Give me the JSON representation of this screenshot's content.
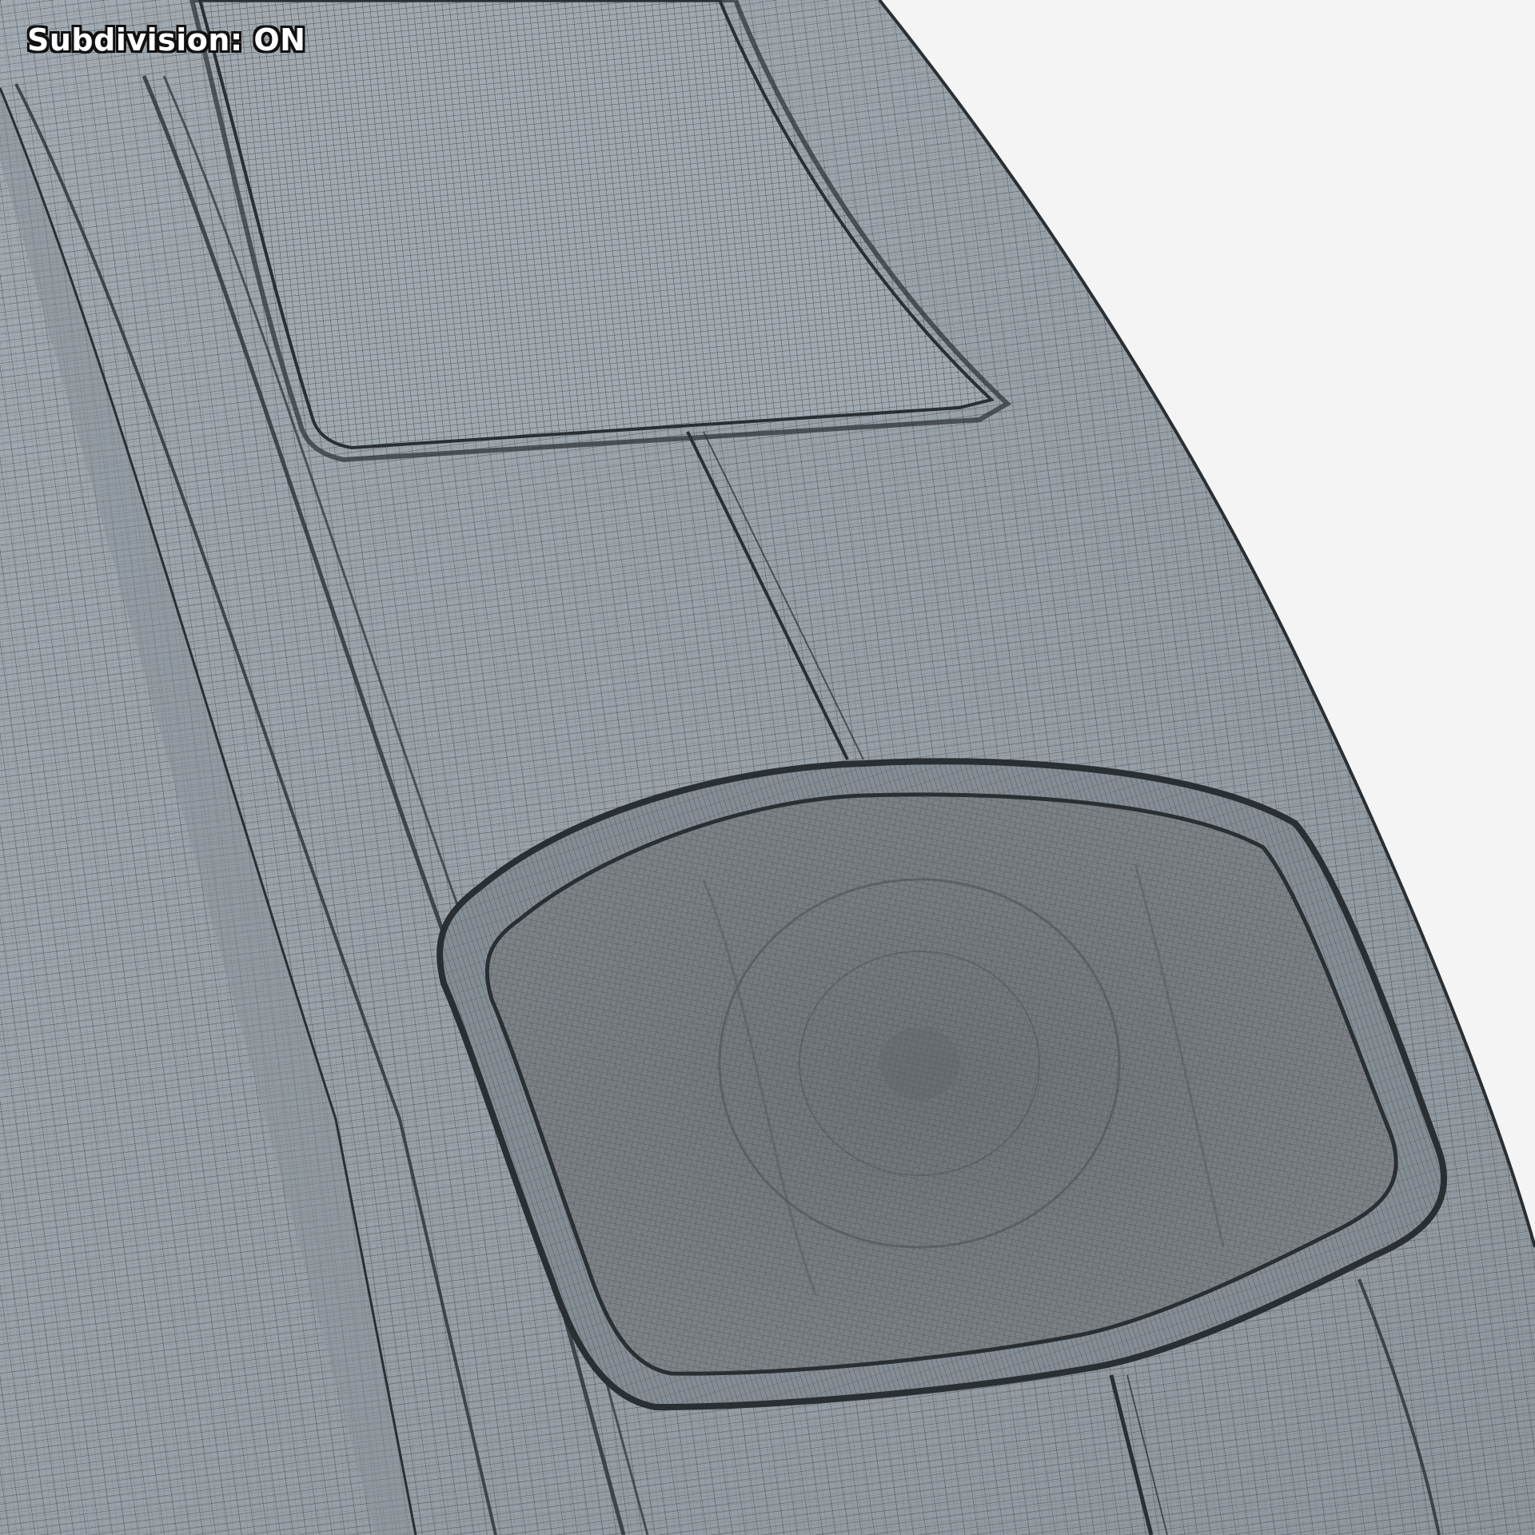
{
  "overlay": {
    "label": "Subdivision: ON"
  },
  "scene": {
    "subject": "wireframe-mesh-render",
    "colors": {
      "background": "#f4f4f4",
      "surface": "#9aa3aa",
      "surface_dark": "#7e868d",
      "wire": "#2a2f33",
      "lens": "#7b8085",
      "lens_dark": "#5e6367"
    }
  }
}
